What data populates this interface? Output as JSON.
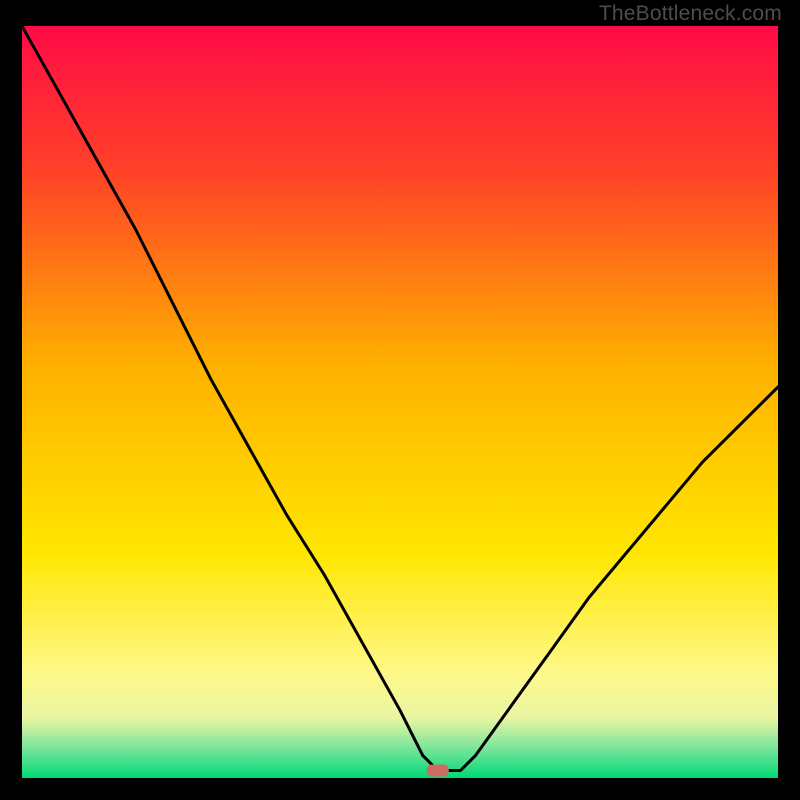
{
  "watermark": "TheBottleneck.com",
  "chart_data": {
    "type": "line",
    "title": "",
    "xlabel": "",
    "ylabel": "",
    "xlim": [
      0,
      100
    ],
    "ylim": [
      0,
      100
    ],
    "x": [
      0,
      5,
      10,
      15,
      20,
      25,
      30,
      35,
      40,
      45,
      50,
      53,
      55,
      56,
      58,
      60,
      65,
      70,
      75,
      80,
      85,
      90,
      95,
      100
    ],
    "values": [
      100,
      91,
      82,
      73,
      63,
      53,
      44,
      35,
      27,
      18,
      9,
      3,
      1,
      1,
      1,
      3,
      10,
      17,
      24,
      30,
      36,
      42,
      47,
      52
    ],
    "gradient_stops": [
      {
        "offset": 0,
        "color": "#ff0b47"
      },
      {
        "offset": 20,
        "color": "#ff4426"
      },
      {
        "offset": 45,
        "color": "#ffb000"
      },
      {
        "offset": 70,
        "color": "#ffe600"
      },
      {
        "offset": 86,
        "color": "#fff88a"
      },
      {
        "offset": 92,
        "color": "#eaf5a2"
      },
      {
        "offset": 96,
        "color": "#7be59a"
      },
      {
        "offset": 100,
        "color": "#00d977"
      }
    ],
    "marker": {
      "x": 55,
      "y": 1,
      "color": "#cf6a60"
    }
  }
}
